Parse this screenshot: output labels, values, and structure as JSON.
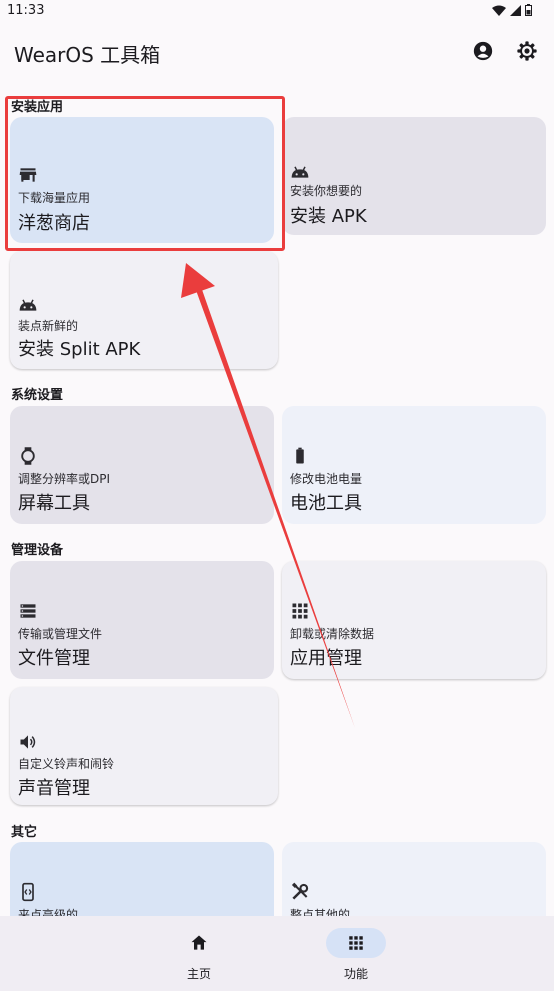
{
  "status_bar": {
    "time": "11:33"
  },
  "app_bar": {
    "title": "WearOS 工具箱",
    "account_icon": "account-circle-icon",
    "settings_icon": "gear-icon"
  },
  "sections": [
    {
      "header": "安装应用"
    },
    {
      "header": "系统设置"
    },
    {
      "header": "管理设备"
    },
    {
      "header": "其它"
    }
  ],
  "cards": {
    "store": {
      "icon": "store-icon",
      "subtitle": "下载海量应用",
      "title": "洋葱商店"
    },
    "install_apk": {
      "icon": "android-icon",
      "subtitle": "安装你想要的",
      "title": "安装 APK"
    },
    "install_split": {
      "icon": "android-icon",
      "subtitle": "装点新鲜的",
      "title": "安装 Split APK"
    },
    "screen_tool": {
      "icon": "watch-icon",
      "subtitle": "调整分辨率或DPI",
      "title": "屏幕工具"
    },
    "battery_tool": {
      "icon": "battery-icon",
      "subtitle": "修改电池电量",
      "title": "电池工具"
    },
    "file_manager": {
      "icon": "storage-icon",
      "subtitle": "传输或管理文件",
      "title": "文件管理"
    },
    "app_manager": {
      "icon": "apps-grid-icon",
      "subtitle": "卸载或清除数据",
      "title": "应用管理"
    },
    "sound_manager": {
      "icon": "volume-icon",
      "subtitle": "自定义铃声和闹铃",
      "title": "声音管理"
    },
    "advanced": {
      "icon": "code-phone-icon",
      "subtitle": "来点高级的"
    },
    "others": {
      "icon": "tools-icon",
      "subtitle": "整点其他的"
    }
  },
  "bottom_nav": [
    {
      "icon": "home-icon",
      "label": "主页",
      "active": false
    },
    {
      "icon": "apps-grid-icon",
      "label": "功能",
      "active": true
    }
  ],
  "colors": {
    "primary_card": "#d9e4f5",
    "neutral_card": "#e4e2ea",
    "annotation_red": "#ea3d3d",
    "active_nav_indicator": "#d6e2f6"
  }
}
